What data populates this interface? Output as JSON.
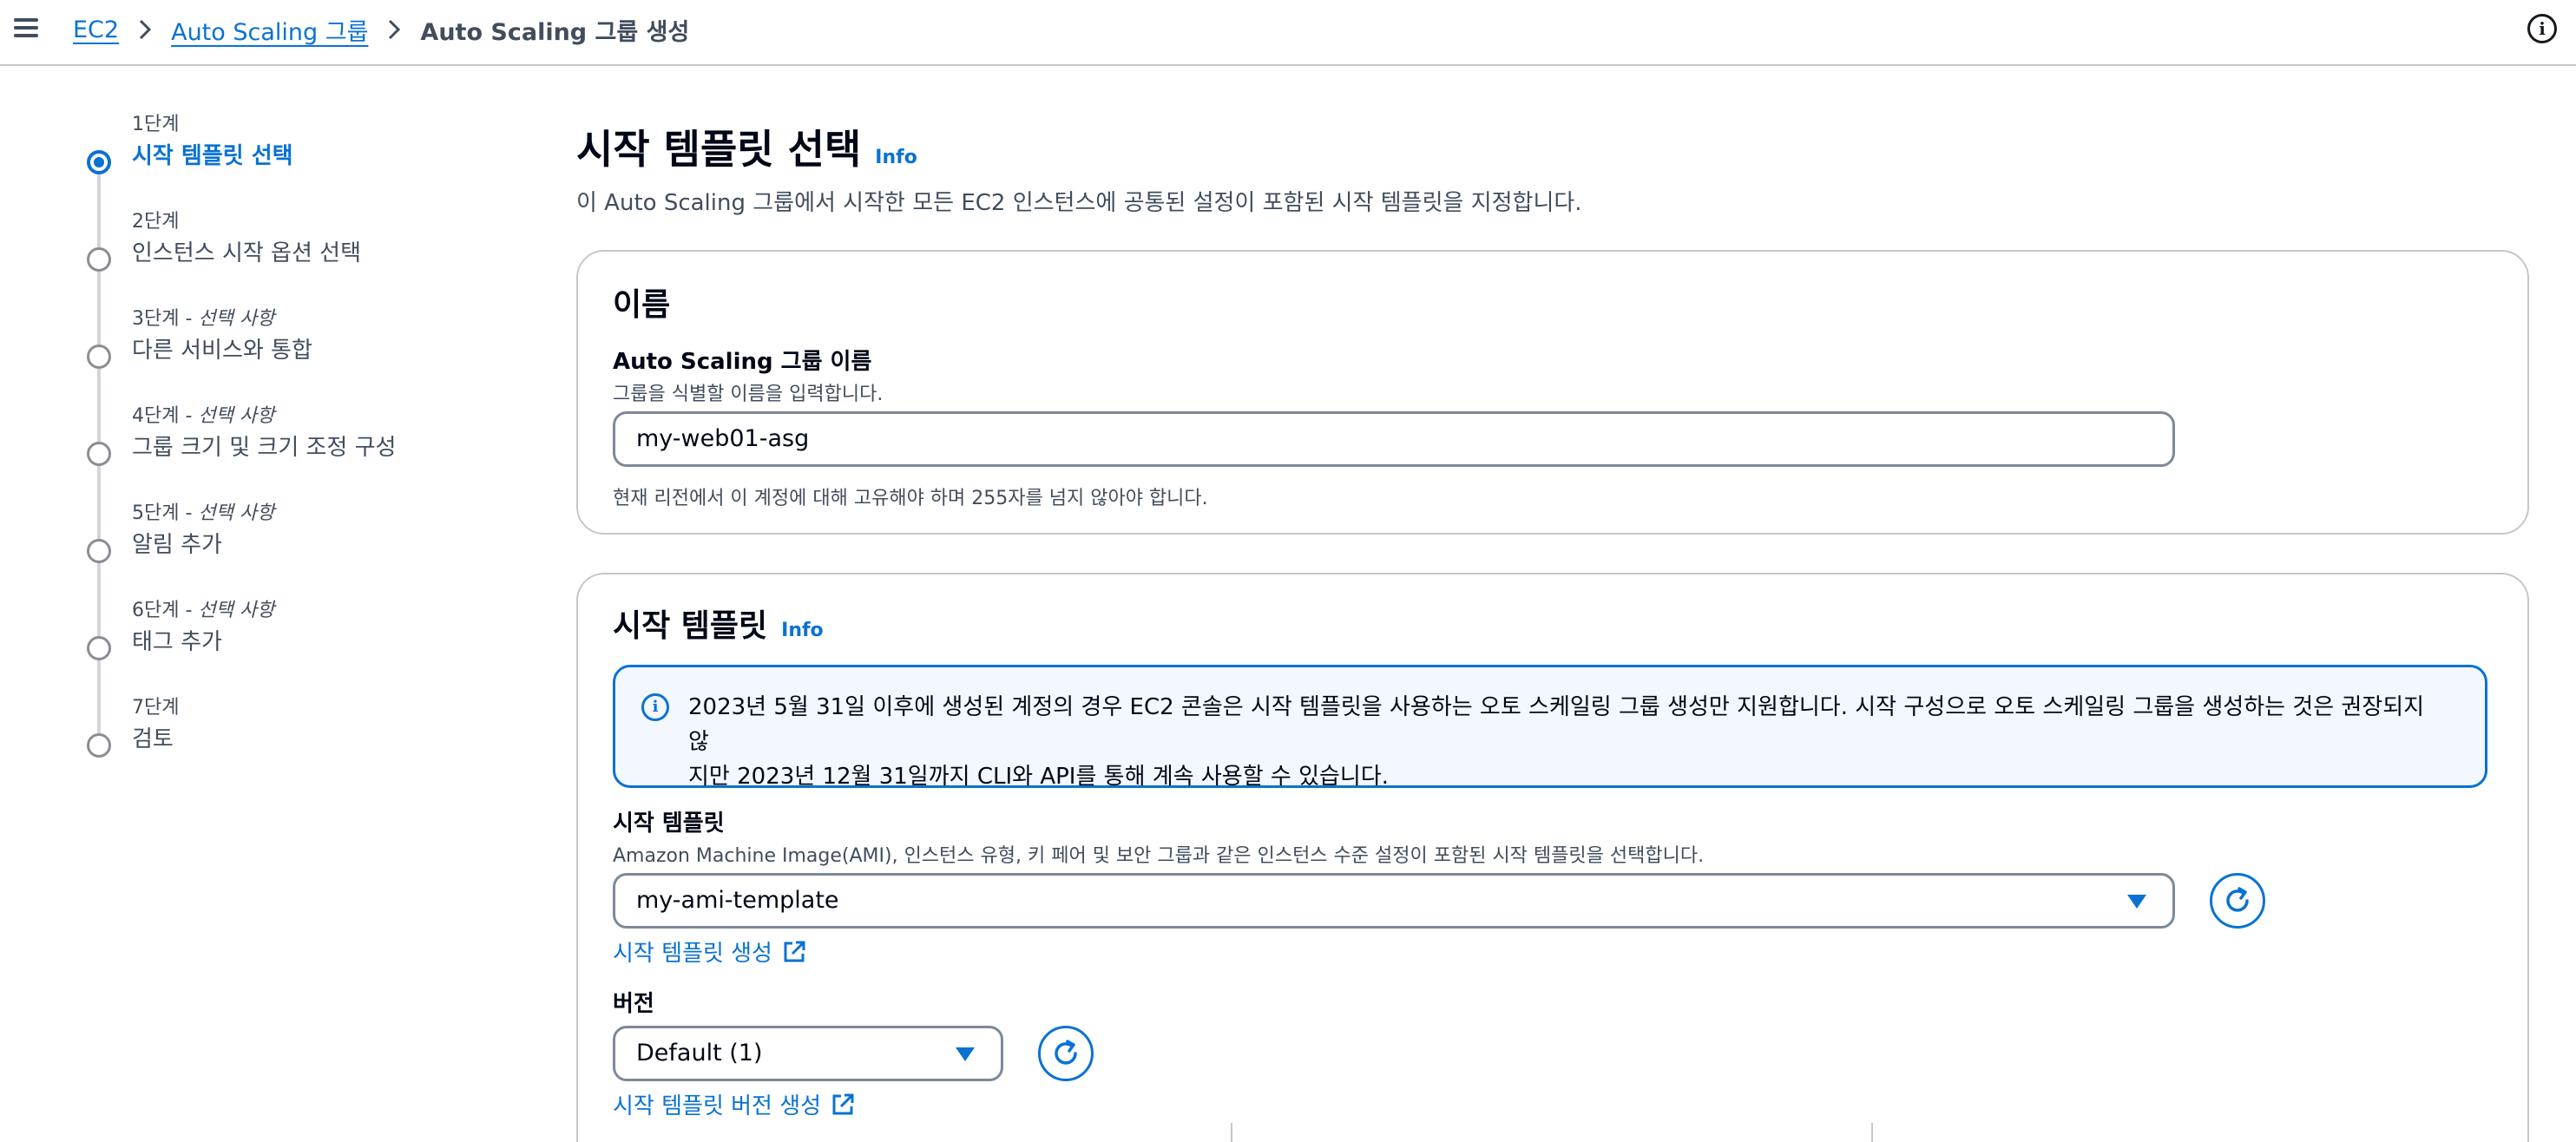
{
  "breadcrumb": {
    "items": [
      "EC2",
      "Auto Scaling 그룹"
    ],
    "current": "Auto Scaling 그룹 생성"
  },
  "steps": [
    {
      "label": "1단계",
      "optional": "",
      "title": "시작 템플릿 선택",
      "active": true
    },
    {
      "label": "2단계",
      "optional": "",
      "title": "인스턴스 시작 옵션 선택"
    },
    {
      "label": "3단계 - ",
      "optional": "선택 사항",
      "title": "다른 서비스와 통합"
    },
    {
      "label": "4단계 - ",
      "optional": "선택 사항",
      "title": "그룹 크기 및 크기 조정 구성"
    },
    {
      "label": "5단계 - ",
      "optional": "선택 사항",
      "title": "알림 추가"
    },
    {
      "label": "6단계 - ",
      "optional": "선택 사항",
      "title": "태그 추가"
    },
    {
      "label": "7단계",
      "optional": "",
      "title": "검토"
    }
  ],
  "page": {
    "title": "시작 템플릿 선택",
    "info": "Info",
    "description": "이 Auto Scaling 그룹에서 시작한 모든 EC2 인스턴스에 공통된 설정이 포함된 시작 템플릿을 지정합니다."
  },
  "name_panel": {
    "heading": "이름",
    "field_label": "Auto Scaling 그룹 이름",
    "field_desc": "그룹을 식별할 이름을 입력합니다.",
    "value": "my-web01-asg",
    "constraint": "현재 리전에서 이 계정에 대해 고유해야 하며 255자를 넘지 않아야 합니다."
  },
  "template_panel": {
    "heading": "시작 템플릿",
    "info": "Info",
    "alert_line1": "2023년 5월 31일 이후에 생성된 계정의 경우 EC2 콘솔은 시작 템플릿을 사용하는 오토 스케일링 그룹 생성만 지원합니다. 시작 구성으로 오토 스케일링 그룹을 생성하는 것은 권장되지 않",
    "alert_line2": "지만 2023년 12월 31일까지 CLI와 API를 통해 계속 사용할 수 있습니다.",
    "template_label": "시작 템플릿",
    "template_desc": "Amazon Machine Image(AMI), 인스턴스 유형, 키 페어 및 보안 그룹과 같은 인스턴스 수준 설정이 포함된 시작 템플릿을 선택합니다.",
    "template_value": "my-ami-template",
    "create_template_link": "시작 템플릿 생성",
    "version_label": "버전",
    "version_value": "Default (1)",
    "create_version_link": "시작 템플릿 버전 생성"
  },
  "colors": {
    "accent": "#0972d3",
    "text": "#000716",
    "muted": "#414d5c",
    "border": "#c6c6cd",
    "alert_bg": "#f2f8fd"
  }
}
